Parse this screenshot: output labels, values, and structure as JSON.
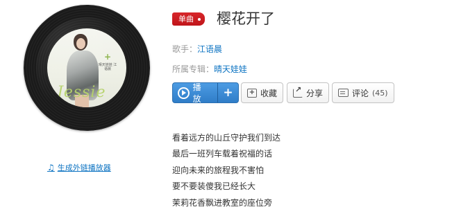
{
  "song": {
    "tag": "单曲",
    "title": "樱花开了"
  },
  "meta": {
    "artist_label": "歌手：",
    "artist": "江语晨",
    "album_label": "所属专辑：",
    "album": "晴天娃娃"
  },
  "actions": {
    "play": "播放",
    "add": "+",
    "collect": "收藏",
    "share": "分享",
    "comment": "评论",
    "comment_count": "(45)"
  },
  "cover_art": {
    "script_text": "Jessie",
    "small_text": "晴天娃娃 江语晨"
  },
  "player_link": {
    "icon": "music-note-icon",
    "label": "生成外链播放器"
  },
  "lyrics": [
    "看着远方的山丘守护我们到达",
    "最后一班列车载着祝福的话",
    "迎向未来的旅程我不害怕",
    "要不要装傻我已经长大",
    "茉莉花香飘进教室的座位旁"
  ],
  "colors": {
    "accent_blue": "#0c73c2",
    "tag_red": "#d7262a",
    "play_blue": "#2f7dc8"
  }
}
